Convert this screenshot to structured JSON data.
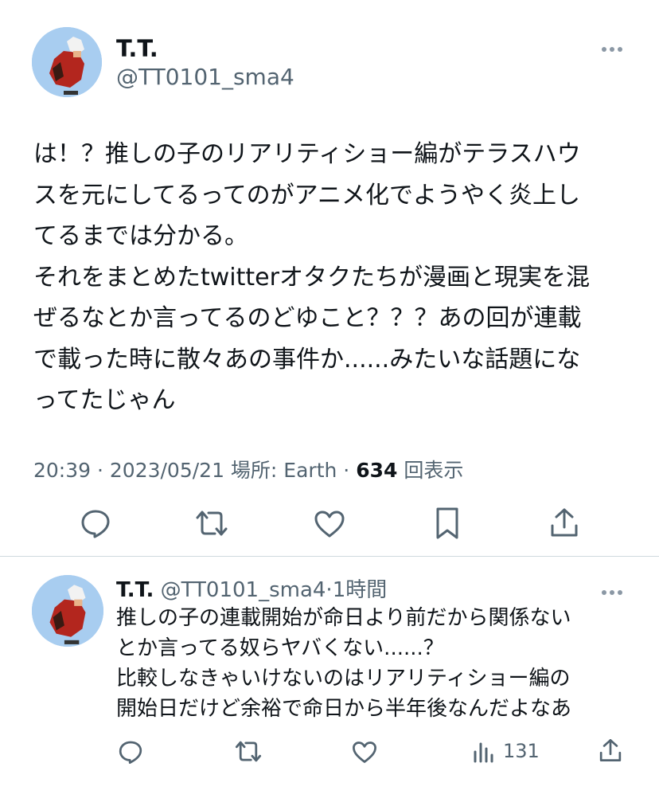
{
  "tweet": {
    "display_name": "T.T.",
    "handle": "@TT0101_sma4",
    "more_icon": "ellipsis-icon",
    "text": "は！？推しの子のリアリティショー編がテラスハウ\nスを元にしてるってのがアニメ化でようやく炎上し\nてるまでは分かる。\nそれをまとめたtwitterオタクたちが漫画と現実を混\nぜるなとか言ってるのどゆこと？？？あの回が連載\nで載った時に散々あの事件か......みたいな話題にな\nってたじゃん",
    "time": "20:39",
    "sep1": " · ",
    "date": "2023/05/21",
    "location": " 場所: Earth",
    "sep2": " · ",
    "views_count": "634",
    "views_label": " 回表示",
    "actions": [
      "reply-icon",
      "retweet-icon",
      "like-icon",
      "bookmark-icon",
      "share-icon"
    ]
  },
  "reply": {
    "display_name": "T.T.",
    "handle": "@TT0101_sma4",
    "sep": "·",
    "time_ago": "1時間",
    "text": "推しの子の連載開始が命日より前だから関係ない\nとか言ってる奴らヤバくない......？\n比較しなきゃいけないのはリアリティショー編の\n開始日だけど余裕で命日から半年後なんだよなあ",
    "views": "131",
    "actions": [
      "reply-icon",
      "retweet-icon",
      "like-icon",
      "views-icon",
      "share-icon"
    ]
  }
}
